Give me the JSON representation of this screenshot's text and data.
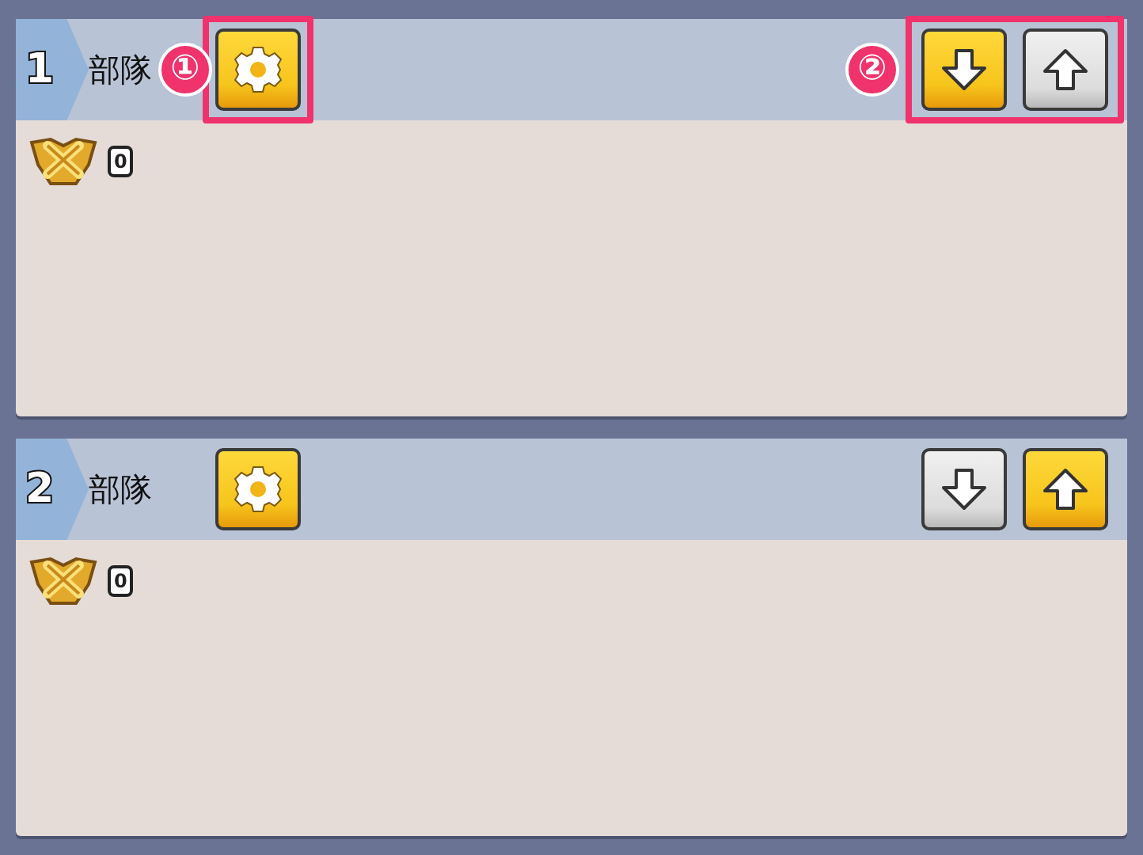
{
  "squads": [
    {
      "number": "1",
      "title": "部隊",
      "settings_callout": "①",
      "move_down": {
        "disabled": false
      },
      "move_up": {
        "disabled": true
      },
      "move_callout": "②",
      "trophies": "0"
    },
    {
      "number": "2",
      "title": "部隊",
      "move_down": {
        "disabled": true
      },
      "move_up": {
        "disabled": false
      },
      "trophies": "0"
    }
  ]
}
